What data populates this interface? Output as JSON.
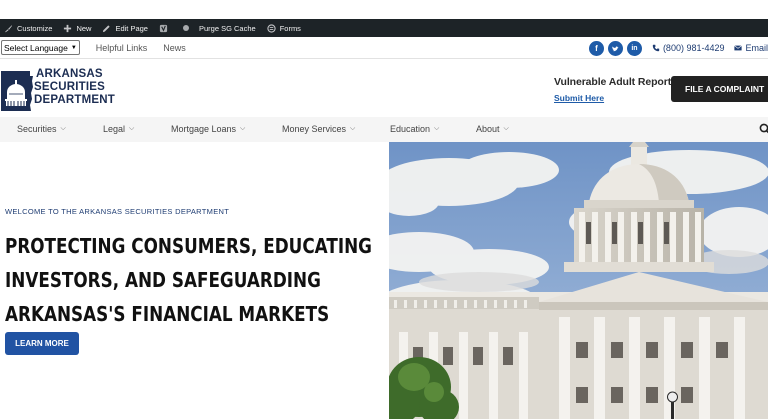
{
  "admin_bar": {
    "items": [
      {
        "label": "Customize",
        "icon": "brush-icon"
      },
      {
        "label": "New",
        "icon": "plus-icon"
      },
      {
        "label": "Edit Page",
        "icon": "pencil-icon"
      },
      {
        "label": "",
        "icon": "yoast-icon"
      },
      {
        "label": "Purge SG Cache",
        "icon": ""
      },
      {
        "label": "Forms",
        "icon": "forms-icon"
      }
    ]
  },
  "utility": {
    "language_select": "Select Language",
    "links": [
      "Helpful Links",
      "News"
    ],
    "social": [
      {
        "name": "facebook-icon",
        "glyph": "f"
      },
      {
        "name": "twitter-icon",
        "glyph": "t"
      },
      {
        "name": "linkedin-icon",
        "glyph": "in"
      }
    ],
    "phone": "(800) 981-4429",
    "email": "Email"
  },
  "header": {
    "logo_lines": [
      "ARKANSAS",
      "SECURITIES",
      "DEPARTMENT"
    ],
    "vulnerable": "Vulnerable Adult Report",
    "submit_here": "Submit Here",
    "complaint_button": "FILE A COMPLAINT"
  },
  "nav": {
    "items": [
      "Securities",
      "Legal",
      "Mortgage Loans",
      "Money Services",
      "Education",
      "About"
    ]
  },
  "hero": {
    "welcome": "WELCOME TO THE ARKANSAS SECURITIES DEPARTMENT",
    "headline": [
      "PROTECTING CONSUMERS, EDUCATING",
      "INVESTORS, AND SAFEGUARDING",
      "ARKANSAS'S FINANCIAL MARKETS"
    ],
    "button": "LEARN MORE"
  },
  "colors": {
    "brand_navy": "#1c2d52",
    "accent_blue": "#2153a3",
    "admin_bg": "#1d2327"
  }
}
